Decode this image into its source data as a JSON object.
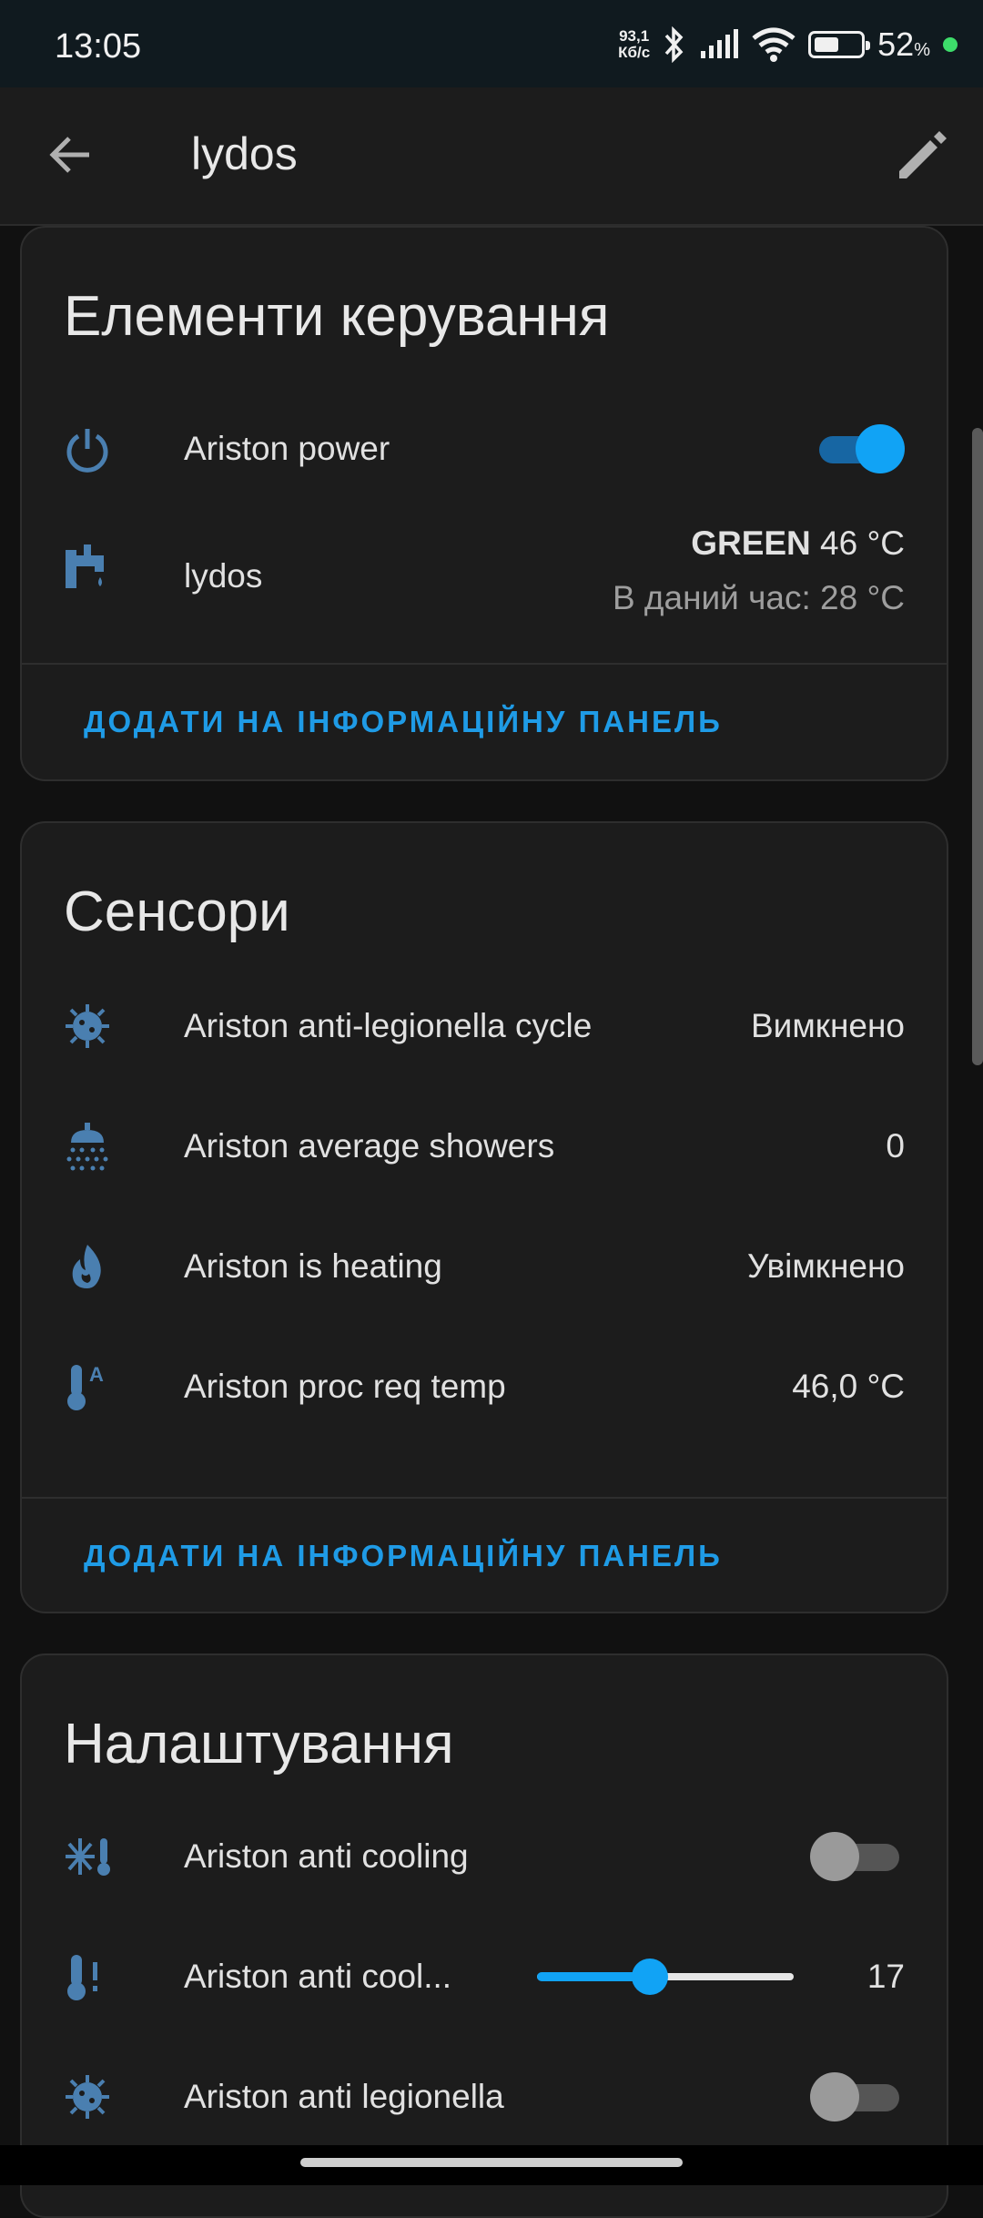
{
  "status_bar": {
    "time": "13:05",
    "net_speed_value": "93,1",
    "net_speed_unit": "Кб/с",
    "battery_percent": "52",
    "percent_sign": "%",
    "battery_level": 0.52
  },
  "app_bar": {
    "title": "lydos"
  },
  "controls": {
    "title": "Елементи керування",
    "rows": [
      {
        "label": "Ariston power",
        "toggle": "on",
        "icon": "power-icon"
      },
      {
        "label": "lydos",
        "mode": "GREEN",
        "target": "46 °C",
        "current": "В даний час: 28 °C",
        "icon": "water-heater-icon"
      }
    ],
    "action": "ДОДАТИ НА ІНФОРМАЦІЙНУ ПАНЕЛЬ"
  },
  "sensors": {
    "title": "Сенсори",
    "rows": [
      {
        "label": "Ariston anti-legionella cycle",
        "value": "Вимкнено",
        "icon": "bacteria-icon"
      },
      {
        "label": "Ariston average showers",
        "value": "0",
        "icon": "shower-icon"
      },
      {
        "label": "Ariston is heating",
        "value": "Увімкнено",
        "icon": "fire-icon"
      },
      {
        "label": "Ariston proc req temp",
        "value": "46,0 °C",
        "icon": "thermometer-auto-icon"
      }
    ],
    "action": "ДОДАТИ НА ІНФОРМАЦІЙНУ ПАНЕЛЬ"
  },
  "settings": {
    "title": "Налаштування",
    "rows": [
      {
        "label": "Ariston anti cooling",
        "toggle": "off",
        "icon": "snowflake-thermometer-icon"
      },
      {
        "label": "Ariston anti cool...",
        "value": "17",
        "slider_fraction": 0.44,
        "icon": "thermometer-alert-icon"
      },
      {
        "label": "Ariston anti legionella",
        "toggle": "off",
        "icon": "bacteria-icon"
      }
    ]
  },
  "colors": {
    "accent": "#11a3f5",
    "icon": "#4a7fb0",
    "card_bg": "#1c1c1c",
    "page_bg": "#111111"
  }
}
